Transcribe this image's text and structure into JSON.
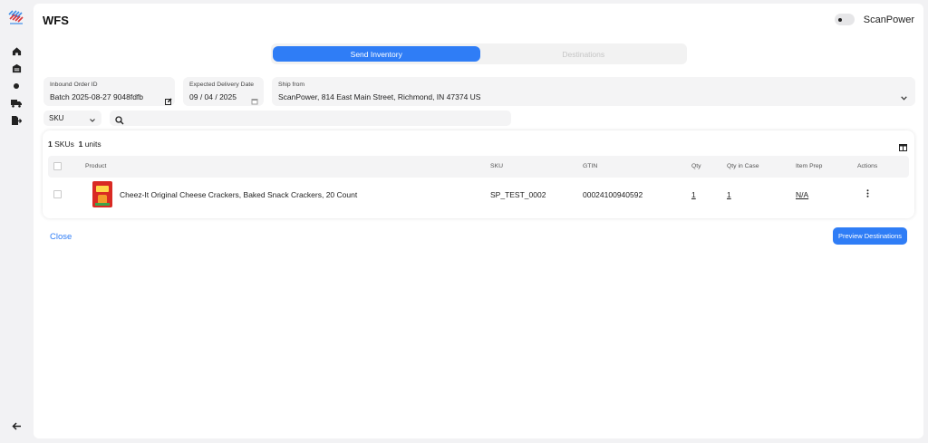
{
  "app": {
    "title": "WFS",
    "brand_name": "ScanPower"
  },
  "tabs": [
    {
      "label": "Send Inventory",
      "active": true
    },
    {
      "label": "Destinations",
      "active": false
    }
  ],
  "form": {
    "inbound_order": {
      "label": "Inbound Order ID",
      "value": "Batch 2025-08-27 9048fdfb"
    },
    "delivery_date": {
      "label": "Expected Delivery Date",
      "value": "09 / 04 / 2025"
    },
    "ship_from": {
      "label": "Ship from",
      "value": "ScanPower, 814 East Main Street, Richmond, IN 47374 US"
    }
  },
  "filter": {
    "select_value": "SKU",
    "search_value": ""
  },
  "table": {
    "sku_count": "1",
    "sku_label": "SKUs",
    "unit_count": "1",
    "unit_label": "units",
    "headers": {
      "product": "Product",
      "sku": "SKU",
      "gtin": "GTIN",
      "qty": "Qty",
      "qty_in_case": "Qty in Case",
      "item_prep": "Item Prep",
      "actions": "Actions"
    },
    "rows": [
      {
        "product": "Cheez-It Original Cheese Crackers, Baked Snack Crackers, 20 Count",
        "sku": "SP_TEST_0002",
        "gtin": "00024100940592",
        "qty": "1",
        "qty_in_case": "1",
        "item_prep": "N/A",
        "actions_icon": "more-vertical-icon"
      }
    ]
  },
  "footer": {
    "close_label": "Close",
    "preview_label": "Preview Destinations"
  },
  "colors": {
    "accent": "#2f7df6",
    "background": "#f2f2f4",
    "field": "#f4f4f5"
  },
  "icons": {
    "rail": [
      "logo-icon",
      "home-icon",
      "warehouse-icon",
      "dot-icon",
      "truck-icon",
      "export-icon",
      "arrow-left-icon"
    ]
  }
}
